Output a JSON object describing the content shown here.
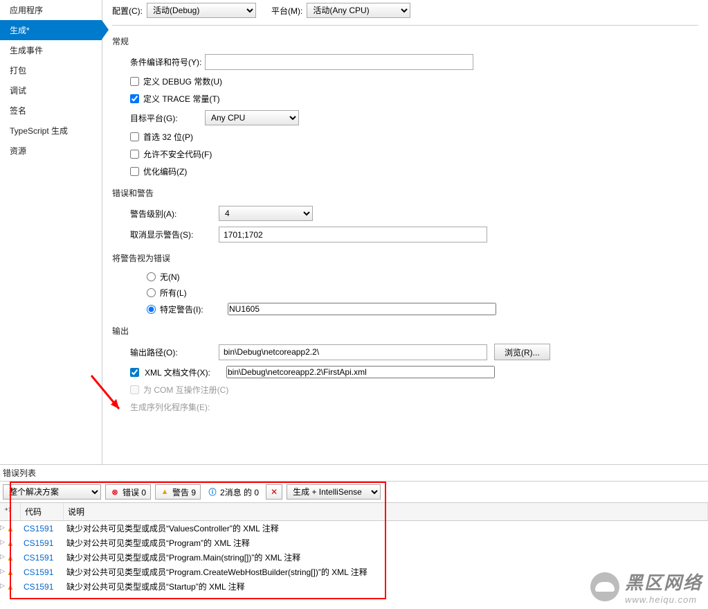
{
  "sidebar": {
    "items": [
      {
        "label": "应用程序"
      },
      {
        "label": "生成*",
        "active": true
      },
      {
        "label": "生成事件"
      },
      {
        "label": "打包"
      },
      {
        "label": "调试"
      },
      {
        "label": "签名"
      },
      {
        "label": "TypeScript 生成"
      },
      {
        "label": "资源"
      }
    ]
  },
  "top": {
    "config_label": "配置(C):",
    "config_value": "活动(Debug)",
    "platform_label": "平台(M):",
    "platform_value": "活动(Any CPU)"
  },
  "sections": {
    "general": "常规",
    "errwarn": "错误和警告",
    "treat": "将警告视为错误",
    "output": "输出"
  },
  "general": {
    "cond_label": "条件编译和符号(Y):",
    "cond_value": "",
    "define_debug": "定义 DEBUG 常数(U)",
    "define_trace": "定义 TRACE 常量(T)",
    "target_label": "目标平台(G):",
    "target_value": "Any CPU",
    "prefer32": "首选 32 位(P)",
    "unsafe": "允许不安全代码(F)",
    "optimize": "优化编码(Z)"
  },
  "errwarn": {
    "level_label": "警告级别(A):",
    "level_value": "4",
    "suppress_label": "取消显示警告(S):",
    "suppress_value": "1701;1702"
  },
  "treat": {
    "none": "无(N)",
    "all": "所有(L)",
    "specific": "特定警告(I):",
    "specific_value": "NU1605"
  },
  "output": {
    "path_label": "输出路径(O):",
    "path_value": "bin\\Debug\\netcoreapp2.2\\",
    "browse": "浏览(R)...",
    "xml_label": "XML 文档文件(X):",
    "xml_value": "bin\\Debug\\netcoreapp2.2\\FirstApi.xml",
    "com": "为 COM 互操作注册(C)",
    "serial": "生成序列化程序集(E):"
  },
  "errors": {
    "title": "错误列表",
    "scope": "整个解决方案",
    "errors_btn": "错误 0",
    "warnings_btn": "警告 9",
    "msgs_btn": "2消息 的 0",
    "source": "生成 + IntelliSense",
    "cols": {
      "code": "代码",
      "desc": "说明"
    },
    "items": [
      {
        "code": "CS1591",
        "desc": "缺少对公共可见类型或成员“ValuesController”的 XML 注释"
      },
      {
        "code": "CS1591",
        "desc": "缺少对公共可见类型或成员“Program”的 XML 注释"
      },
      {
        "code": "CS1591",
        "desc": "缺少对公共可见类型或成员“Program.Main(string[])”的 XML 注释"
      },
      {
        "code": "CS1591",
        "desc": "缺少对公共可见类型或成员“Program.CreateWebHostBuilder(string[])”的 XML 注释"
      },
      {
        "code": "CS1591",
        "desc": "缺少对公共可见类型或成员“Startup”的 XML 注释"
      }
    ]
  },
  "watermark": {
    "main": "黑区网络",
    "sub": "www.heiqu.com"
  }
}
